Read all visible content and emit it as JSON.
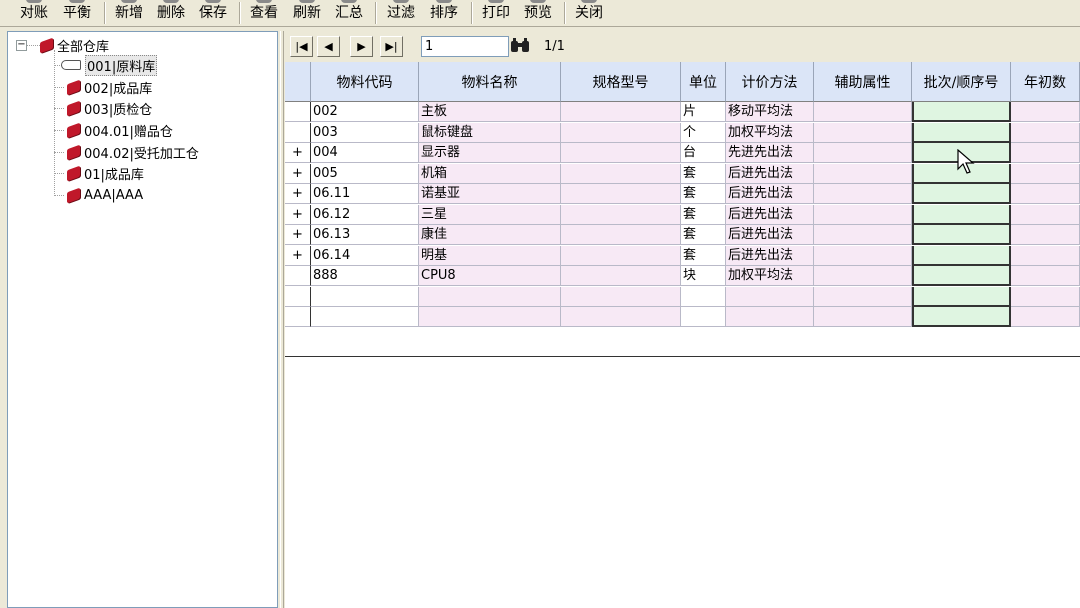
{
  "toolbar": {
    "buttons": [
      {
        "label": "对账"
      },
      {
        "label": "平衡"
      },
      {
        "label": "新增"
      },
      {
        "label": "删除"
      },
      {
        "label": "保存"
      },
      {
        "label": "查看"
      },
      {
        "label": "刷新"
      },
      {
        "label": "汇总"
      },
      {
        "label": "过滤"
      },
      {
        "label": "排序"
      },
      {
        "label": "打印"
      },
      {
        "label": "预览"
      },
      {
        "label": "关闭"
      }
    ]
  },
  "tree": {
    "expander": "−",
    "root": "全部仓库",
    "items": [
      {
        "label": "001|原料库",
        "icon": "hand-icon"
      },
      {
        "label": "002|成品库",
        "icon": "book-icon"
      },
      {
        "label": "003|质检仓",
        "icon": "book-icon"
      },
      {
        "label": "004.01|赠品仓",
        "icon": "book-icon"
      },
      {
        "label": "004.02|受托加工仓",
        "icon": "book-icon"
      },
      {
        "label": "01|成品库",
        "icon": "book-icon"
      },
      {
        "label": "AAA|AAA",
        "icon": "book-icon"
      }
    ]
  },
  "nav": {
    "first": "|◀",
    "prev": "◀",
    "next": "▶",
    "last": "▶|",
    "page_value": "1",
    "find_icon": "binoculars-icon",
    "page_count": "1/1"
  },
  "grid": {
    "columns": [
      "物料代码",
      "物料名称",
      "规格型号",
      "单位",
      "计价方法",
      "辅助属性",
      "批次/顺序号",
      "年初数"
    ],
    "rows": [
      {
        "ind": "",
        "code": "002",
        "name": "主板",
        "spec": "",
        "unit": "片",
        "method": "移动平均法",
        "aux": "",
        "batch": "",
        "init": ""
      },
      {
        "ind": "",
        "code": "003",
        "name": "鼠标键盘",
        "spec": "",
        "unit": "个",
        "method": "加权平均法",
        "aux": "",
        "batch": "",
        "init": ""
      },
      {
        "ind": "+",
        "code": "004",
        "name": "显示器",
        "spec": "",
        "unit": "台",
        "method": "先进先出法",
        "aux": "",
        "batch": "",
        "init": ""
      },
      {
        "ind": "+",
        "code": "005",
        "name": "机箱",
        "spec": "",
        "unit": "套",
        "method": "后进先出法",
        "aux": "",
        "batch": "",
        "init": ""
      },
      {
        "ind": "+",
        "code": "06.11",
        "name": "诺基亚",
        "spec": "",
        "unit": "套",
        "method": "后进先出法",
        "aux": "",
        "batch": "",
        "init": ""
      },
      {
        "ind": "+",
        "code": "06.12",
        "name": "三星",
        "spec": "",
        "unit": "套",
        "method": "后进先出法",
        "aux": "",
        "batch": "",
        "init": ""
      },
      {
        "ind": "+",
        "code": "06.13",
        "name": "康佳",
        "spec": "",
        "unit": "套",
        "method": "后进先出法",
        "aux": "",
        "batch": "",
        "init": ""
      },
      {
        "ind": "+",
        "code": "06.14",
        "name": "明基",
        "spec": "",
        "unit": "套",
        "method": "后进先出法",
        "aux": "",
        "batch": "",
        "init": ""
      },
      {
        "ind": "",
        "code": "888",
        "name": "CPU8",
        "spec": "",
        "unit": "块",
        "method": "加权平均法",
        "aux": "",
        "batch": "",
        "init": ""
      },
      {
        "ind": "",
        "code": "",
        "name": "",
        "spec": "",
        "unit": "",
        "method": "",
        "aux": "",
        "batch": "",
        "init": ""
      },
      {
        "ind": "",
        "code": "",
        "name": "",
        "spec": "",
        "unit": "",
        "method": "",
        "aux": "",
        "batch": "",
        "init": ""
      }
    ]
  }
}
